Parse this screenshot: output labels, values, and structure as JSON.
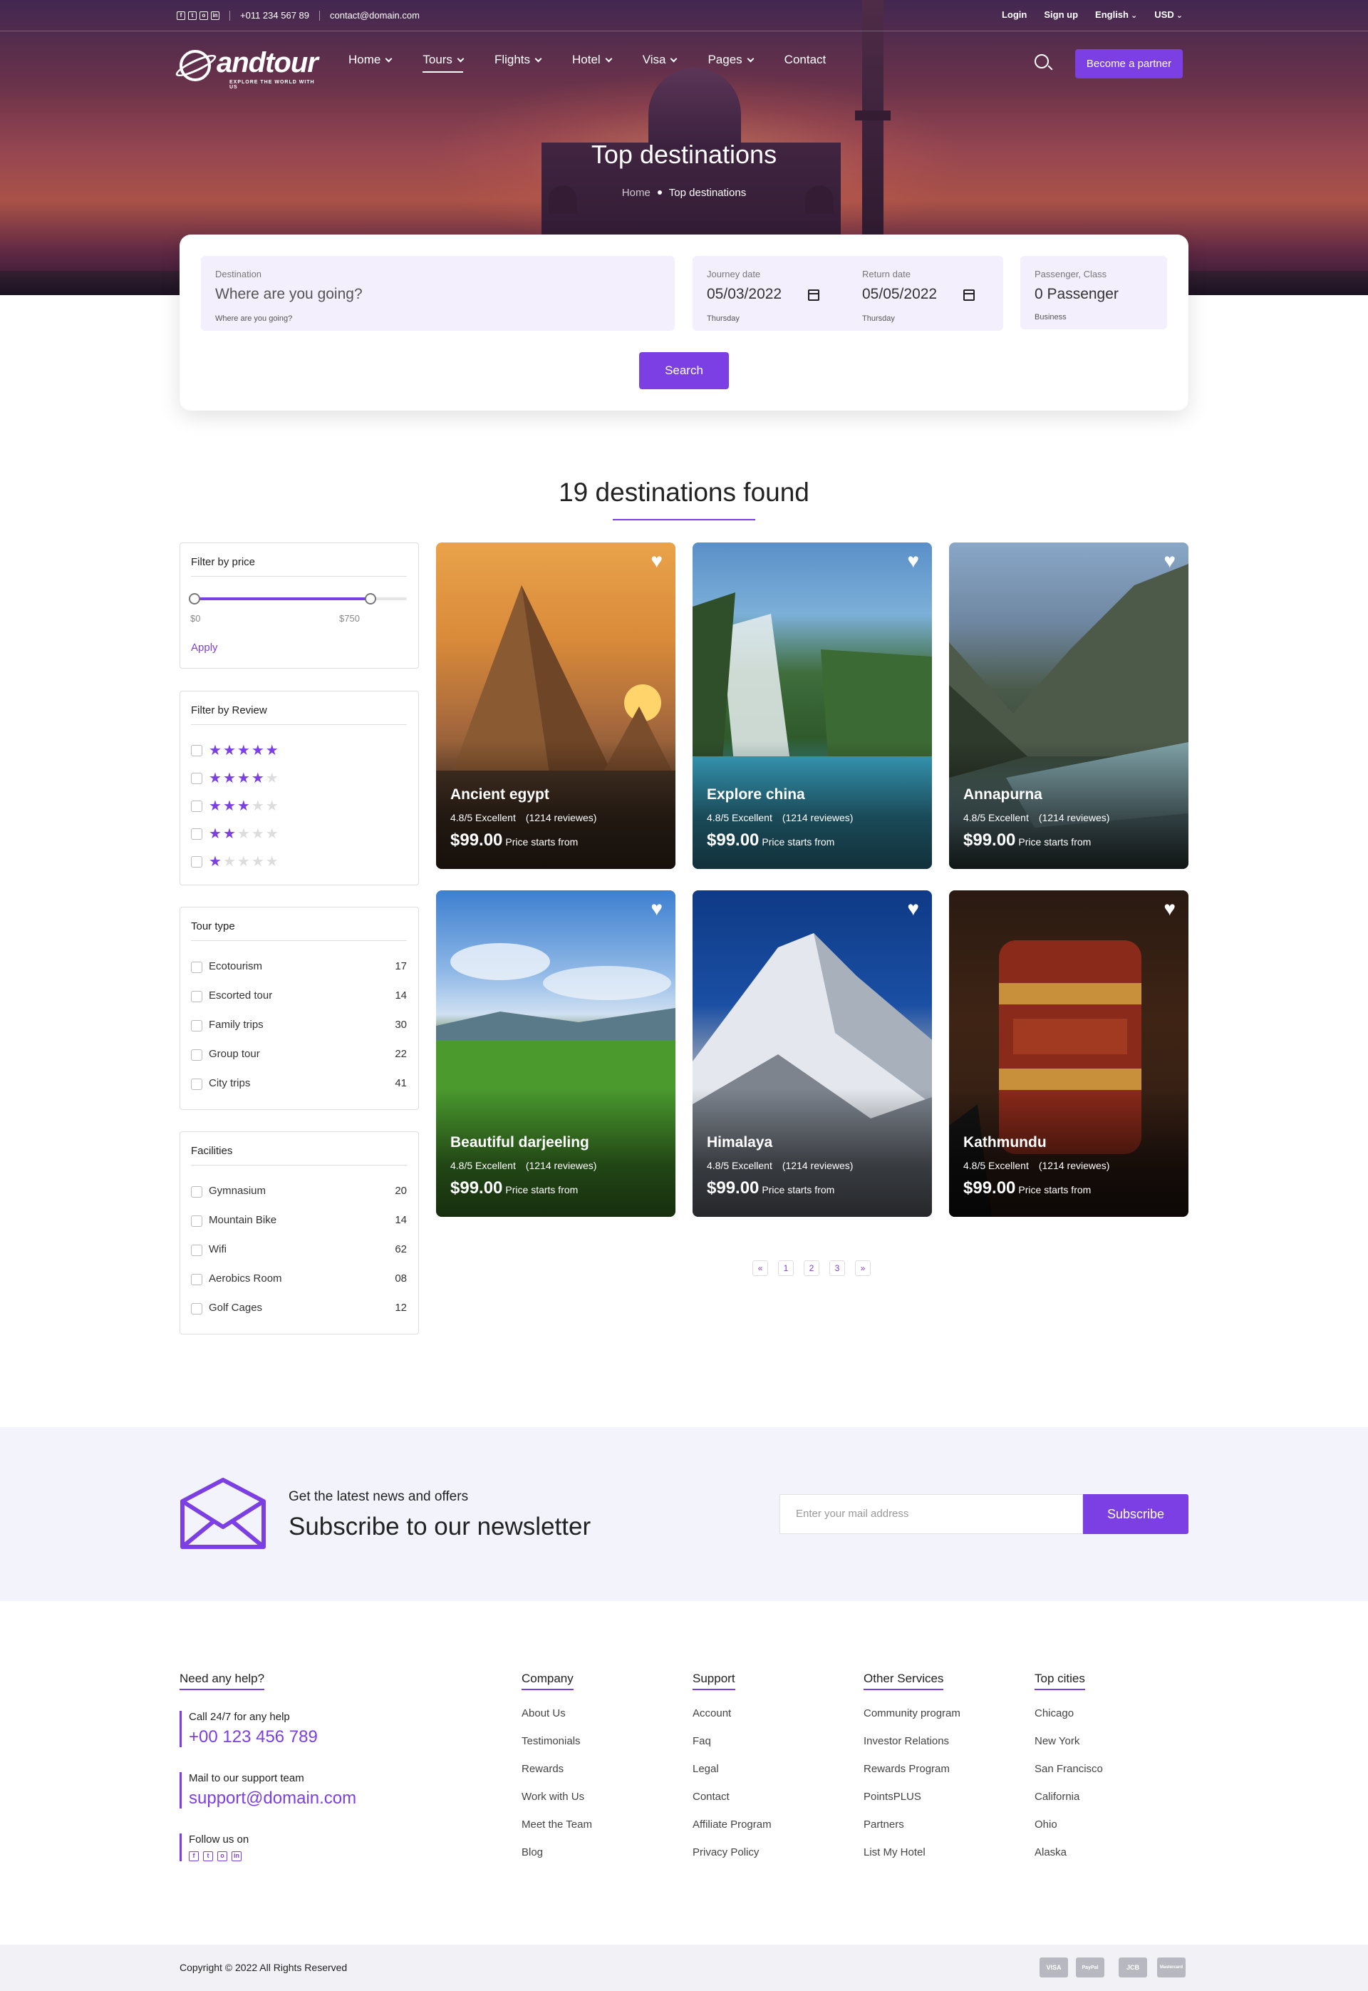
{
  "topbar": {
    "phone": "+011 234 567 89",
    "email": "contact@domain.com",
    "login": "Login",
    "signup": "Sign up",
    "language": "English",
    "currency": "USD",
    "social": [
      "facebook-icon",
      "twitter-icon",
      "instagram-icon",
      "linkedin-icon"
    ]
  },
  "brand": {
    "name": "andtour",
    "tagline": "EXPLORE THE WORLD WITH US"
  },
  "nav": {
    "items": [
      "Home",
      "Tours",
      "Flights",
      "Hotel",
      "Visa",
      "Pages",
      "Contact"
    ],
    "active": "Tours",
    "partner": "Become a partner"
  },
  "hero": {
    "title": "Top destinations",
    "crumb_home": "Home",
    "crumb_current": "Top destinations"
  },
  "search": {
    "destination": {
      "label": "Destination",
      "placeholder": "Where are you going?",
      "hint": "Where are you going?"
    },
    "journey": {
      "label": "Journey date",
      "value": "05/03/2022",
      "day": "Thursday"
    },
    "return": {
      "label": "Return date",
      "value": "05/05/2022",
      "day": "Thursday"
    },
    "passenger": {
      "label": "Passenger, Class",
      "value": "0 Passenger",
      "class": "Business"
    },
    "button": "Search"
  },
  "results": {
    "heading": "19 destinations found"
  },
  "filters": {
    "price": {
      "title": "Filter by price",
      "min": "$0",
      "max": "$750",
      "apply": "Apply",
      "range_fraction": [
        0,
        0.83
      ]
    },
    "review": {
      "title": "Filter by Review",
      "ratings": [
        5,
        4,
        3,
        2,
        1
      ]
    },
    "tour_type": {
      "title": "Tour type",
      "options": [
        {
          "label": "Ecotourism",
          "count": "17"
        },
        {
          "label": "Escorted tour",
          "count": "14"
        },
        {
          "label": "Family trips",
          "count": "30"
        },
        {
          "label": "Group tour",
          "count": "22"
        },
        {
          "label": "City trips",
          "count": "41"
        }
      ]
    },
    "facilities": {
      "title": "Facilities",
      "options": [
        {
          "label": "Gymnasium",
          "count": "20"
        },
        {
          "label": "Mountain Bike",
          "count": "14"
        },
        {
          "label": "Wifi",
          "count": "62"
        },
        {
          "label": "Aerobics Room",
          "count": "08"
        },
        {
          "label": "Golf Cages",
          "count": "12"
        }
      ]
    }
  },
  "cards": [
    {
      "name": "Ancient egypt",
      "rating": "4.8/5 Excellent",
      "reviews": "(1214 reviewes)",
      "price": "$99.00",
      "note": "Price starts from"
    },
    {
      "name": "Explore china",
      "rating": "4.8/5 Excellent",
      "reviews": "(1214 reviewes)",
      "price": "$99.00",
      "note": "Price starts from"
    },
    {
      "name": "Annapurna",
      "rating": "4.8/5 Excellent",
      "reviews": "(1214 reviewes)",
      "price": "$99.00",
      "note": "Price starts from"
    },
    {
      "name": "Beautiful darjeeling",
      "rating": "4.8/5 Excellent",
      "reviews": "(1214 reviewes)",
      "price": "$99.00",
      "note": "Price starts from"
    },
    {
      "name": "Himalaya",
      "rating": "4.8/5 Excellent",
      "reviews": "(1214 reviewes)",
      "price": "$99.00",
      "note": "Price starts from"
    },
    {
      "name": "Kathmundu",
      "rating": "4.8/5 Excellent",
      "reviews": "(1214 reviewes)",
      "price": "$99.00",
      "note": "Price starts from"
    }
  ],
  "pagination": [
    "«",
    "1",
    "2",
    "3",
    "»"
  ],
  "newsletter": {
    "kicker": "Get the latest news and offers",
    "headline": "Subscribe to our newsletter",
    "placeholder": "Enter your mail address",
    "button": "Subscribe"
  },
  "footer": {
    "help": {
      "title": "Need any help?",
      "call_label": "Call 24/7 for any help",
      "call_value": "+00 123 456 789",
      "mail_label": "Mail to our support team",
      "mail_value": "support@domain.com",
      "follow_label": "Follow us on"
    },
    "columns": [
      {
        "title": "Company",
        "links": [
          "About Us",
          "Testimonials",
          "Rewards",
          "Work with Us",
          "Meet the Team",
          "Blog"
        ]
      },
      {
        "title": "Support",
        "links": [
          "Account",
          "Faq",
          "Legal",
          "Contact",
          "Affiliate Program",
          "Privacy Policy"
        ]
      },
      {
        "title": "Other Services",
        "links": [
          "Community program",
          "Investor Relations",
          "Rewards Program",
          "PointsPLUS",
          "Partners",
          "List My Hotel"
        ]
      },
      {
        "title": "Top cities",
        "links": [
          "Chicago",
          "New York",
          "San Francisco",
          "California",
          "Ohio",
          "Alaska"
        ]
      }
    ],
    "copyright": "Copyright © 2022 All Rights Reserved",
    "payments": [
      "VISA",
      "PayPal",
      "JCB",
      "Mastercard"
    ]
  },
  "colors": {
    "accent": "#7b3fe4",
    "panel_bg": "#f4effd",
    "newsletter_bg": "#f3f3fb"
  }
}
